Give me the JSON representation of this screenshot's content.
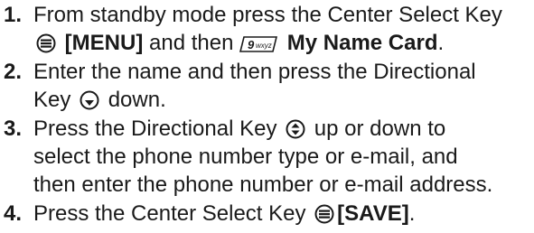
{
  "steps": [
    {
      "number": "1.",
      "line1": "From standby mode press the Center Select Key",
      "menu_label": "[MENU]",
      "and_then": " and then ",
      "keypad_glyph": "9wxyz",
      "my_name_card": "My Name Card",
      "period": "."
    },
    {
      "number": "2.",
      "line1": "Enter the name and then press the Directional",
      "key_text": "Key ",
      "after_icon": " down."
    },
    {
      "number": "3.",
      "line1_before": "Press the Directional Key ",
      "line1_after": " up or down to",
      "line2": "select the phone number type or e-mail, and",
      "line3": "then enter the phone number or e-mail address."
    },
    {
      "number": "4.",
      "text_before": "Press the Center Select Key ",
      "save_label": "[SAVE]",
      "period": "."
    }
  ],
  "icons": {
    "center_select": "center-select-key-icon",
    "directional_down": "directional-key-down-icon",
    "directional_updown": "directional-key-updown-icon",
    "keypad_9": "keypad-9-wxyz-icon"
  }
}
